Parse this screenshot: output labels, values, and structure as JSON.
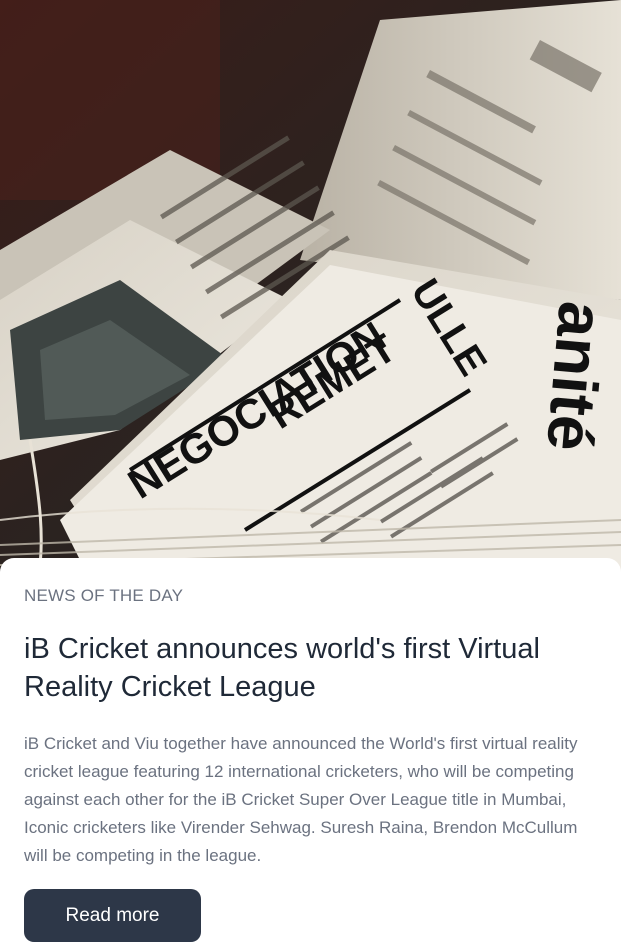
{
  "hero": {
    "alt": "Stack of old French newspapers",
    "headline_fragments": [
      "ULLE",
      "NEGOCIATION",
      "REMET",
      "anité"
    ]
  },
  "article": {
    "eyebrow": "NEWS OF THE DAY",
    "title": "iB Cricket announces world's first Virtual Reality Cricket League",
    "summary": "iB Cricket and Viu together have announced the World's first virtual reality cricket league featuring 12 international cricketers, who will be competing against each other for the iB Cricket Super Over League title in Mumbai, Iconic cricketers like Virender Sehwag. Suresh Raina, Brendon McCullum will be competing in the league.",
    "cta_label": "Read more"
  },
  "colors": {
    "button_bg": "#2d3748",
    "title": "#1f2937",
    "muted": "#6b7280"
  }
}
